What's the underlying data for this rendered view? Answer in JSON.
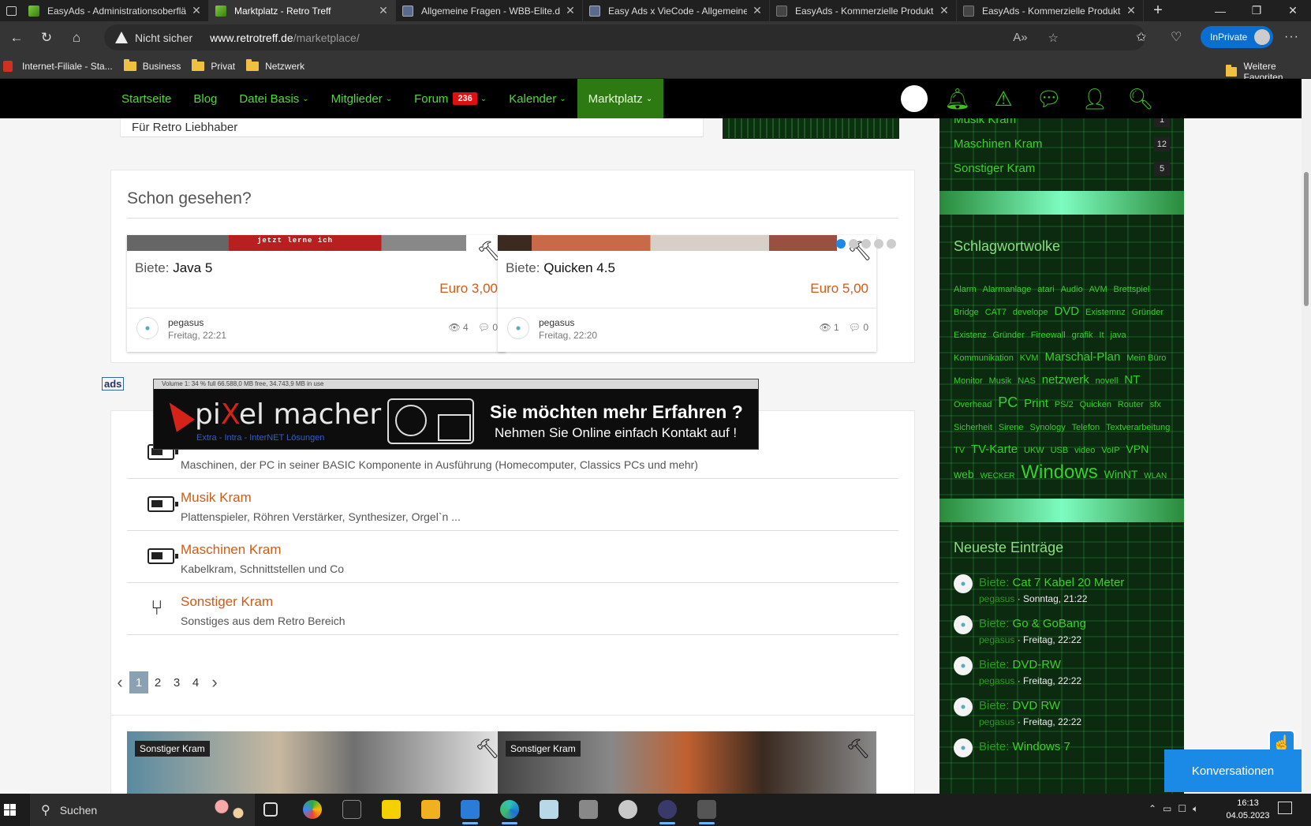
{
  "browser": {
    "tabs": [
      {
        "title": "EasyAds - Administrationsoberflä",
        "active": false,
        "icon": "vcode-icon"
      },
      {
        "title": "Marktplatz - Retro Treff",
        "active": true,
        "icon": "vcode-icon"
      },
      {
        "title": "Allgemeine Fragen - WBB-Elite.d",
        "active": false,
        "icon": "wbb-icon"
      },
      {
        "title": "Easy Ads x VieCode - Allgemeine",
        "active": false,
        "icon": "wbb-icon"
      },
      {
        "title": "EasyAds - Kommerzielle Produkte",
        "active": false,
        "icon": "doc-icon"
      },
      {
        "title": "EasyAds - Kommerzielle Produkte",
        "active": false,
        "icon": "doc-icon"
      }
    ],
    "security": "Nicht sicher",
    "url_host": "www.retrotreff.de",
    "url_path": "/marketplace/",
    "inprivate": "InPrivate",
    "bookmarks": [
      "Internet-Filiale - Sta...",
      "Business",
      "Privat",
      "Netzwerk"
    ],
    "other_favorites": "Weitere Favoriten"
  },
  "nav": {
    "items": [
      {
        "label": "Startseite",
        "chevron": false
      },
      {
        "label": "Blog",
        "chevron": false
      },
      {
        "label": "Datei Basis",
        "chevron": true
      },
      {
        "label": "Mitglieder",
        "chevron": true
      },
      {
        "label": "Forum",
        "chevron": true,
        "badge": "236"
      },
      {
        "label": "Kalender",
        "chevron": true
      },
      {
        "label": "Marktplatz",
        "chevron": true,
        "active": true
      }
    ]
  },
  "top_card": {
    "text": "Für Retro Liebhaber"
  },
  "seen": {
    "title": "Schon gesehen?",
    "items": [
      {
        "prefix": "Biete:",
        "title": "Java 5",
        "price": "Euro 3,00",
        "user": "pegasus",
        "time": "Freitag, 22:21",
        "views": "4",
        "comments": "0",
        "banner": "jetzt lerne ich"
      },
      {
        "prefix": "Biete:",
        "title": "Quicken 4.5",
        "price": "Euro 5,00",
        "user": "pegasus",
        "time": "Freitag, 22:20",
        "views": "1",
        "comments": "0"
      }
    ]
  },
  "ads_label": "ads",
  "ad": {
    "bar": "Volume 1:  34 % full 66.588,0 MB free, 34.743,9 MB in use",
    "logo_a": "pi",
    "logo_x": "X",
    "logo_b": "el macher",
    "sub": "Extra - Intra - InterNET Lösungen",
    "headline": "Sie möchten mehr Erfahren ?",
    "subline": "Nehmen Sie Online einfach Kontakt auf !"
  },
  "categories": [
    {
      "name": "",
      "desc": "Maschinen, der PC in seiner BASIC Komponente in Ausführung (Homecomputer, Classics PCs und mehr)",
      "icon": "battery-icon"
    },
    {
      "name": "Musik Kram",
      "desc": "Plattenspieler, Röhren Verstärker, Synthesizer, Orgel`n ...",
      "icon": "battery-icon"
    },
    {
      "name": "Maschinen Kram",
      "desc": "Kabelkram, Schnittstellen und Co",
      "icon": "battery-icon"
    },
    {
      "name": "Sonstiger Kram",
      "desc": "Sonstiges aus dem Retro Bereich",
      "icon": "branch-icon"
    }
  ],
  "pager": {
    "pages": [
      "1",
      "2",
      "3",
      "4"
    ],
    "current": "1"
  },
  "bottom_cards": [
    {
      "tag": "Sonstiger Kram"
    },
    {
      "tag": "Sonstiger Kram"
    }
  ],
  "sidebar": {
    "categories": [
      {
        "name": "Musik Kram",
        "count": "1"
      },
      {
        "name": "Maschinen Kram",
        "count": "12"
      },
      {
        "name": "Sonstiger Kram",
        "count": "5"
      }
    ],
    "tagcloud_title": "Schlagwortwolke",
    "tags": [
      {
        "t": "Alarm",
        "s": 11
      },
      {
        "t": "Alarmanlage",
        "s": 11
      },
      {
        "t": "atari",
        "s": 11
      },
      {
        "t": "Audio",
        "s": 11
      },
      {
        "t": "AVM",
        "s": 11
      },
      {
        "t": "Brettspiel",
        "s": 11
      },
      {
        "t": "Bridge",
        "s": 11
      },
      {
        "t": "CAT7",
        "s": 11
      },
      {
        "t": "develope",
        "s": 11
      },
      {
        "t": "DVD",
        "s": 15
      },
      {
        "t": "Existemnz",
        "s": 11
      },
      {
        "t": "Gründer",
        "s": 11
      },
      {
        "t": "Existenz",
        "s": 11
      },
      {
        "t": "Gründer",
        "s": 11
      },
      {
        "t": "Fireewall",
        "s": 11
      },
      {
        "t": "grafik",
        "s": 11
      },
      {
        "t": "It",
        "s": 11
      },
      {
        "t": "java",
        "s": 11
      },
      {
        "t": "Kommunikation",
        "s": 11
      },
      {
        "t": "KVM",
        "s": 11
      },
      {
        "t": "Marschal-Plan",
        "s": 15
      },
      {
        "t": "Mein Büro",
        "s": 11
      },
      {
        "t": "Monitor",
        "s": 11
      },
      {
        "t": "Musik",
        "s": 11
      },
      {
        "t": "NAS",
        "s": 11
      },
      {
        "t": "netzwerk",
        "s": 15
      },
      {
        "t": "novell",
        "s": 11
      },
      {
        "t": "NT",
        "s": 15
      },
      {
        "t": "Overhead",
        "s": 11
      },
      {
        "t": "PC",
        "s": 18
      },
      {
        "t": "Print",
        "s": 15
      },
      {
        "t": "PS/2",
        "s": 11
      },
      {
        "t": "Quicken",
        "s": 11
      },
      {
        "t": "Router",
        "s": 11
      },
      {
        "t": "sfx",
        "s": 11
      },
      {
        "t": "Sicherheit",
        "s": 11
      },
      {
        "t": "Sirene",
        "s": 11
      },
      {
        "t": "Synology",
        "s": 11
      },
      {
        "t": "Telefon",
        "s": 11
      },
      {
        "t": "Textverarbeitung",
        "s": 11
      },
      {
        "t": "TV",
        "s": 11
      },
      {
        "t": "TV-Karte",
        "s": 15
      },
      {
        "t": "UKW",
        "s": 11
      },
      {
        "t": "USB",
        "s": 11
      },
      {
        "t": "video",
        "s": 11
      },
      {
        "t": "VoIP",
        "s": 11
      },
      {
        "t": "VPN",
        "s": 14
      },
      {
        "t": "web",
        "s": 14
      },
      {
        "t": "WECKER",
        "s": 10
      },
      {
        "t": "Windows",
        "s": 24
      },
      {
        "t": "WinNT",
        "s": 14
      },
      {
        "t": "WLAN",
        "s": 10
      }
    ],
    "latest_title": "Neueste Einträge",
    "latest": [
      {
        "prefix": "Biete:",
        "title": "Cat 7 Kabel 20 Meter",
        "user": "pegasus",
        "time": "Sonntag, 21:22"
      },
      {
        "prefix": "Biete:",
        "title": "Go & GoBang",
        "user": "pegasus",
        "time": "Freitag, 22:22"
      },
      {
        "prefix": "Biete:",
        "title": "DVD-RW",
        "user": "pegasus",
        "time": "Freitag, 22:22"
      },
      {
        "prefix": "Biete:",
        "title": "DVD RW",
        "user": "pegasus",
        "time": "Freitag, 22:22"
      },
      {
        "prefix": "Biete:",
        "title": "Windows 7",
        "user": "",
        "time": ""
      }
    ]
  },
  "conversations": "Konversationen",
  "taskbar": {
    "search": "Suchen",
    "time": "16:13",
    "date": "04.05.2023"
  }
}
